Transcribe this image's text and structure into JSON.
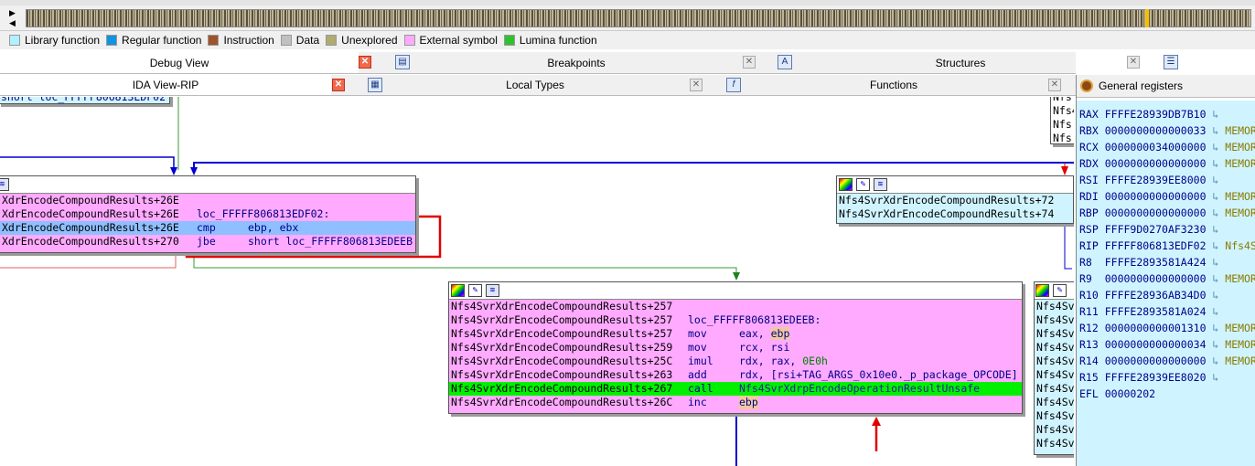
{
  "legend": [
    {
      "label": "Library function",
      "color": "#b0f0ff"
    },
    {
      "label": "Regular function",
      "color": "#1094e0"
    },
    {
      "label": "Instruction",
      "color": "#a0522d"
    },
    {
      "label": "Data",
      "color": "#c0c0c0"
    },
    {
      "label": "Unexplored",
      "color": "#b0ab70"
    },
    {
      "label": "External symbol",
      "color": "#ffaaff"
    },
    {
      "label": "Lumina function",
      "color": "#30c030"
    }
  ],
  "tabs_row1": [
    {
      "label": "Debug View",
      "icon": "debug-view-icon"
    },
    {
      "label": "Breakpoints",
      "icon": "breakpoints-icon"
    },
    {
      "label": "Structures",
      "icon": "structures-icon"
    }
  ],
  "tabs_row2": [
    {
      "label": "IDA View-RIP",
      "icon": "ida-view-icon"
    },
    {
      "label": "Local Types",
      "icon": "local-types-icon"
    },
    {
      "label": "Functions",
      "icon": "functions-icon"
    }
  ],
  "graph": {
    "top_fragment": "short loc_FFFFF806813EDF02",
    "left_node": [
      {
        "addr": "XdrEncodeCompoundResults+26E",
        "label": "",
        "mnem": "",
        "ops": ""
      },
      {
        "addr": "XdrEncodeCompoundResults+26E",
        "label": "loc_FFFFF806813EDF02:",
        "mnem": "",
        "ops": ""
      },
      {
        "addr": "XdrEncodeCompoundResults+26E",
        "label": "",
        "mnem": "cmp",
        "ops": "ebp, ebx"
      },
      {
        "addr": "XdrEncodeCompoundResults+270",
        "label": "",
        "mnem": "jbe",
        "ops": "short loc_FFFFF806813EDEEB"
      }
    ],
    "right_node": [
      "Nfs4SvrXdrEncodeCompoundResults+72",
      "Nfs4SvrXdrEncodeCompoundResults+74"
    ],
    "main_node": [
      {
        "addr": "Nfs4SvrXdrEncodeCompoundResults+257",
        "text": ""
      },
      {
        "addr": "Nfs4SvrXdrEncodeCompoundResults+257",
        "text": "loc_FFFFF806813EDEEB:"
      },
      {
        "addr": "Nfs4SvrXdrEncodeCompoundResults+257",
        "mnem": "mov",
        "op1": "eax, ",
        "op2": "ebp"
      },
      {
        "addr": "Nfs4SvrXdrEncodeCompoundResults+259",
        "mnem": "mov",
        "op1": "rcx, rsi"
      },
      {
        "addr": "Nfs4SvrXdrEncodeCompoundResults+25C",
        "mnem": "imul",
        "op1": "rdx, rax, ",
        "op2": "0E0h"
      },
      {
        "addr": "Nfs4SvrXdrEncodeCompoundResults+263",
        "mnem": "add",
        "op1": "rdx, [rsi+TAG_ARGS_0x10e0._p_package_OPCODE]"
      },
      {
        "addr": "Nfs4SvrXdrEncodeCompoundResults+267",
        "mnem": "call",
        "op1": "Nfs4SvrXdrpEncodeOperationResultUnsafe"
      },
      {
        "addr": "Nfs4SvrXdrEncodeCompoundResults+26C",
        "mnem": "inc",
        "op2": "ebp"
      }
    ],
    "top_right_fragment": [
      "Nfs",
      "Nfs4",
      "Nfs",
      "Nfs"
    ],
    "far_right_prefix": "Nfs4Sv"
  },
  "registers": {
    "title": "General registers",
    "rows": [
      {
        "name": "RAX",
        "value": "FFFFE28939DB7B10",
        "note": ""
      },
      {
        "name": "RBX",
        "value": "0000000000000033",
        "note": "MEMOR"
      },
      {
        "name": "RCX",
        "value": "0000000034000000",
        "note": "MEMOR"
      },
      {
        "name": "RDX",
        "value": "0000000000000000",
        "note": "MEMOR"
      },
      {
        "name": "RSI",
        "value": "FFFFE28939EE8000",
        "note": ""
      },
      {
        "name": "RDI",
        "value": "0000000000000000",
        "note": "MEMOR"
      },
      {
        "name": "RBP",
        "value": "0000000000000000",
        "note": "MEMOR"
      },
      {
        "name": "RSP",
        "value": "FFFF9D0270AF3230",
        "note": ""
      },
      {
        "name": "RIP",
        "value": "FFFFF806813EDF02",
        "note": "Nfs4S"
      },
      {
        "name": "R8 ",
        "value": "FFFFE2893581A424",
        "note": ""
      },
      {
        "name": "R9 ",
        "value": "0000000000000000",
        "note": "MEMOR"
      },
      {
        "name": "R10",
        "value": "FFFFE28936AB34D0",
        "note": ""
      },
      {
        "name": "R11",
        "value": "FFFFE2893581A024",
        "note": ""
      },
      {
        "name": "R12",
        "value": "0000000000001310",
        "note": "MEMOR"
      },
      {
        "name": "R13",
        "value": "0000000000000034",
        "note": "MEMOR"
      },
      {
        "name": "R14",
        "value": "0000000000000000",
        "note": "MEMOR"
      },
      {
        "name": "R15",
        "value": "FFFFE28939EE8020",
        "note": ""
      },
      {
        "name": "EFL",
        "value": "00000202",
        "note": ""
      }
    ]
  }
}
